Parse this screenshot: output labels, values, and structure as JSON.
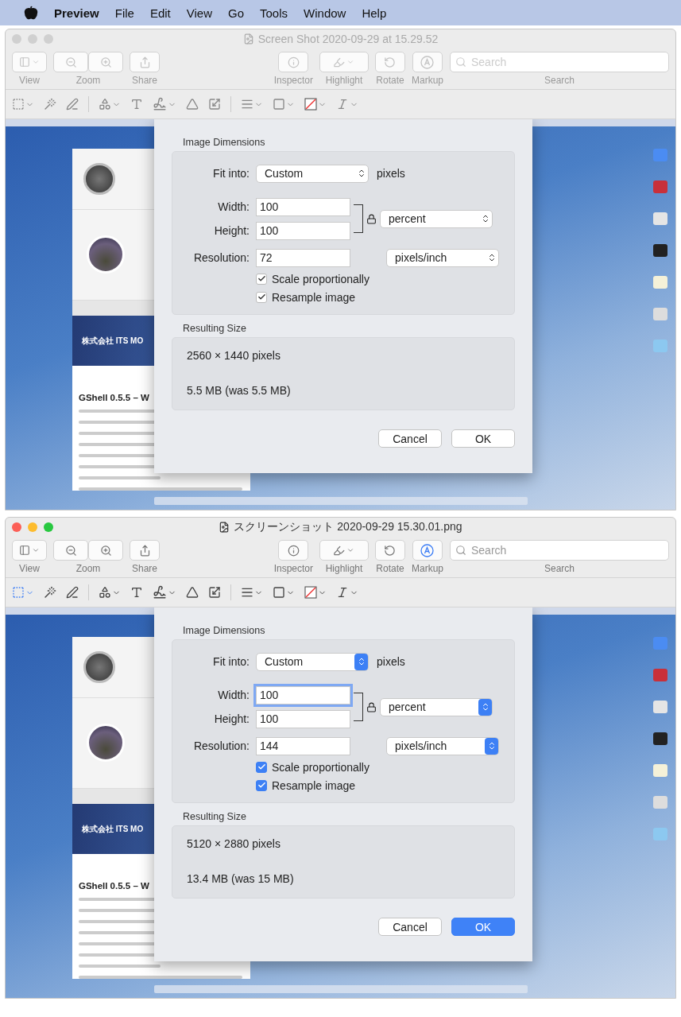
{
  "menu_bar": {
    "app_name": "Preview",
    "menus": [
      "File",
      "Edit",
      "View",
      "Go",
      "Tools",
      "Window",
      "Help"
    ]
  },
  "windows": [
    {
      "title": "Screen Shot 2020-09-29 at 15.29.52",
      "active": false,
      "toolbar_labels": {
        "view": "View",
        "zoom": "Zoom",
        "share": "Share",
        "inspector": "Inspector",
        "highlight": "Highlight",
        "rotate": "Rotate",
        "markup": "Markup",
        "search": "Search"
      },
      "search_placeholder": "Search",
      "screenshot": {
        "banner_title": "株式会社 ITS MO",
        "headline": "GShell 0.5.5 – W"
      },
      "dialog": {
        "dimensions_title": "Image Dimensions",
        "fit_label": "Fit into:",
        "fit_value": "Custom",
        "fit_unit": "pixels",
        "width_label": "Width:",
        "width_value": "100",
        "width_focused": false,
        "height_label": "Height:",
        "height_value": "100",
        "size_unit": "percent",
        "resolution_label": "Resolution:",
        "resolution_value": "72",
        "resolution_unit": "pixels/inch",
        "checkboxes": [
          {
            "label": "Scale proportionally",
            "checked": true
          },
          {
            "label": "Resample image",
            "checked": true
          }
        ],
        "result_title": "Resulting Size",
        "result_pixels": "2560 × 1440 pixels",
        "result_size": "5.5 MB (was 5.5 MB)",
        "cancel": "Cancel",
        "ok": "OK"
      }
    },
    {
      "title": "スクリーンショット 2020-09-29 15.30.01.png",
      "active": true,
      "toolbar_labels": {
        "view": "View",
        "zoom": "Zoom",
        "share": "Share",
        "inspector": "Inspector",
        "highlight": "Highlight",
        "rotate": "Rotate",
        "markup": "Markup",
        "search": "Search"
      },
      "search_placeholder": "Search",
      "screenshot": {
        "banner_title": "株式会社 ITS MO",
        "headline": "GShell 0.5.5 – W"
      },
      "dialog": {
        "dimensions_title": "Image Dimensions",
        "fit_label": "Fit into:",
        "fit_value": "Custom",
        "fit_unit": "pixels",
        "width_label": "Width:",
        "width_value": "100",
        "width_focused": true,
        "height_label": "Height:",
        "height_value": "100",
        "size_unit": "percent",
        "resolution_label": "Resolution:",
        "resolution_value": "144",
        "resolution_unit": "pixels/inch",
        "checkboxes": [
          {
            "label": "Scale proportionally",
            "checked": true
          },
          {
            "label": "Resample image",
            "checked": true
          }
        ],
        "result_title": "Resulting Size",
        "result_pixels": "5120 × 2880 pixels",
        "result_size": "13.4 MB (was 15 MB)",
        "cancel": "Cancel",
        "ok": "OK"
      }
    }
  ]
}
